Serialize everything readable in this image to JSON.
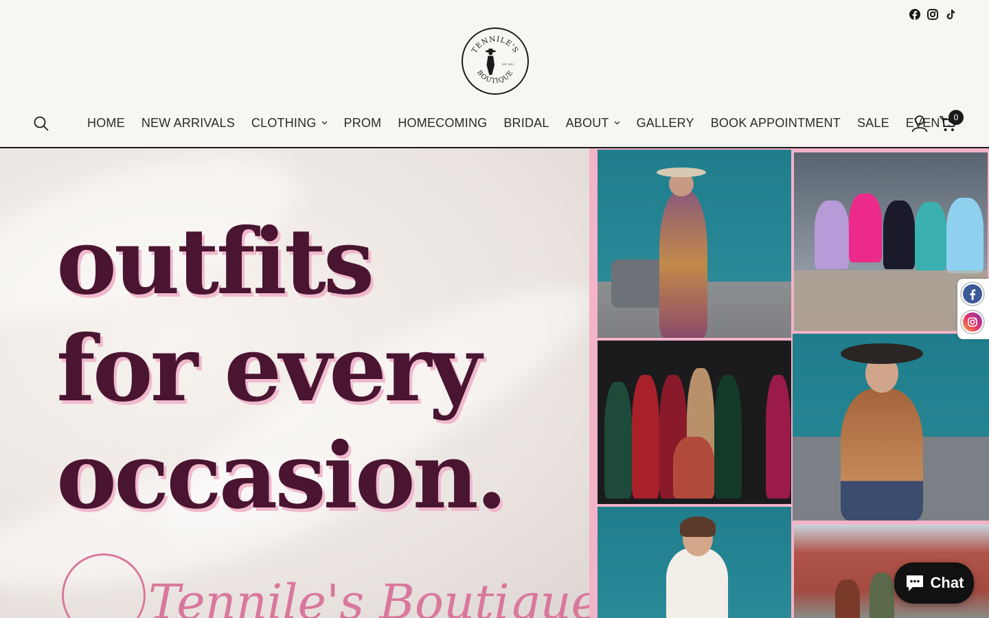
{
  "store": {
    "name": "Tennile's Boutique",
    "logo_text": "TENNILE'S BOUTIQUE",
    "logo_est": "EST. 2012"
  },
  "social_top": [
    "facebook-icon",
    "instagram-icon",
    "tiktok-icon"
  ],
  "nav": {
    "items": [
      {
        "label": "HOME",
        "dropdown": false
      },
      {
        "label": "NEW ARRIVALS",
        "dropdown": false
      },
      {
        "label": "CLOTHING",
        "dropdown": true
      },
      {
        "label": "PROM",
        "dropdown": false
      },
      {
        "label": "HOMECOMING",
        "dropdown": false
      },
      {
        "label": "BRIDAL",
        "dropdown": false
      },
      {
        "label": "ABOUT",
        "dropdown": true
      },
      {
        "label": "GALLERY",
        "dropdown": false
      },
      {
        "label": "BOOK APPOINTMENT",
        "dropdown": false
      },
      {
        "label": "SALE",
        "dropdown": false
      },
      {
        "label": "EVENTS",
        "dropdown": false
      }
    ],
    "cart_count": "0"
  },
  "hero": {
    "tagline": [
      "outfits",
      "for every",
      "occasion."
    ],
    "brand_script": "Tennile's Boutique"
  },
  "chat": {
    "label": "Chat"
  },
  "colors": {
    "accent": "#4a1530",
    "pink": "#f0b9cd",
    "brand_pink": "#d9789c",
    "teal": "#1f7d8c"
  }
}
